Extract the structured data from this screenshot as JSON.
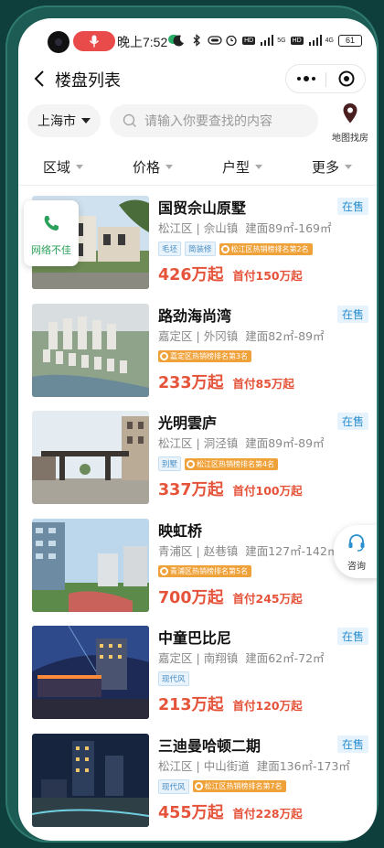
{
  "status_bar": {
    "time": "晚上7:52",
    "battery": "61",
    "hd1": "HD",
    "net1": "5G",
    "hd2": "HD",
    "net2": "4G"
  },
  "header": {
    "title": "楼盘列表"
  },
  "search": {
    "city": "上海市",
    "placeholder": "请输入你要查找的内容",
    "map_label": "地图找房"
  },
  "filters": [
    "区域",
    "价格",
    "户型",
    "更多"
  ],
  "float_network": "网络不佳",
  "float_consult": "咨询",
  "colors": {
    "price": "#e5533a",
    "status": "#2b8fd0",
    "rank_badge": "#f0a23a",
    "network_green": "#2aa05a"
  },
  "listings": [
    {
      "name": "国贸佘山原墅",
      "status": "在售",
      "district": "松江区",
      "town": "佘山镇",
      "area": "建面89㎡-169㎡",
      "tags": [
        "毛坯",
        "简装修"
      ],
      "rank": "松江区热销榜排名第2名",
      "price": "426万起",
      "down_payment": "首付150万起"
    },
    {
      "name": "路劲海尚湾",
      "status": "在售",
      "district": "嘉定区",
      "town": "外冈镇",
      "area": "建面82㎡-89㎡",
      "tags": [],
      "rank": "嘉定区热销榜排名第3名",
      "price": "233万起",
      "down_payment": "首付85万起"
    },
    {
      "name": "光明雲庐",
      "status": "在售",
      "district": "松江区",
      "town": "洞泾镇",
      "area": "建面89㎡-89㎡",
      "tags": [
        "别墅"
      ],
      "rank": "松江区热销榜排名第4名",
      "price": "337万起",
      "down_payment": "首付100万起"
    },
    {
      "name": "映虹桥",
      "status": "",
      "district": "青浦区",
      "town": "赵巷镇",
      "area": "建面127㎡-142㎡",
      "tags": [],
      "rank": "青浦区热销榜排名第5名",
      "price": "700万起",
      "down_payment": "首付245万起"
    },
    {
      "name": "中童巴比尼",
      "status": "在售",
      "district": "嘉定区",
      "town": "南翔镇",
      "area": "建面62㎡-72㎡",
      "tags": [
        "现代风"
      ],
      "rank": "",
      "price": "213万起",
      "down_payment": "首付120万起"
    },
    {
      "name": "三迪曼哈顿二期",
      "status": "在售",
      "district": "松江区",
      "town": "中山街道",
      "area": "建面136㎡-173㎡",
      "tags": [
        "现代风"
      ],
      "rank": "松江区热销榜排名第7名",
      "price": "455万起",
      "down_payment": "首付228万起"
    }
  ]
}
